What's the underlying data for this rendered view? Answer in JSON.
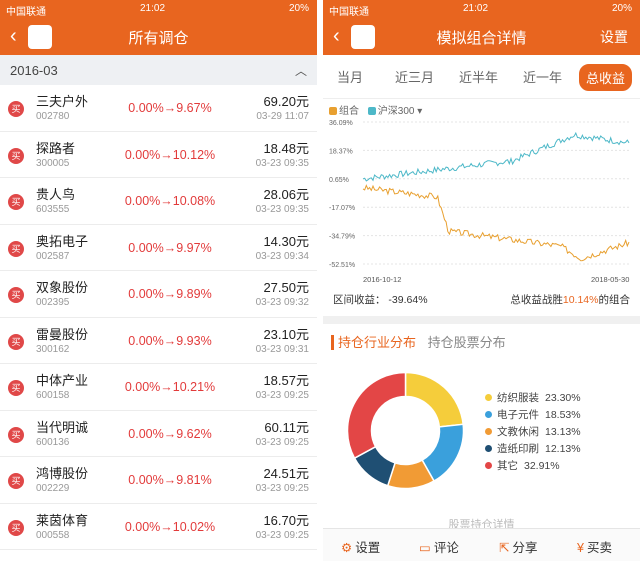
{
  "left": {
    "status": {
      "carrier": "中国联通",
      "time": "21:02",
      "battery": "20%"
    },
    "nav": {
      "title": "所有调仓"
    },
    "section": {
      "label": "2016-03"
    },
    "rows": [
      {
        "badge": "买",
        "name": "三夫户外",
        "code": "002780",
        "change": "0.00%→9.67%",
        "price": "69.20元",
        "time": "03-29 11:07"
      },
      {
        "badge": "买",
        "name": "探路者",
        "code": "300005",
        "change": "0.00%→10.12%",
        "price": "18.48元",
        "time": "03-23 09:35"
      },
      {
        "badge": "买",
        "name": "贵人鸟",
        "code": "603555",
        "change": "0.00%→10.08%",
        "price": "28.06元",
        "time": "03-23 09:35"
      },
      {
        "badge": "买",
        "name": "奥拓电子",
        "code": "002587",
        "change": "0.00%→9.97%",
        "price": "14.30元",
        "time": "03-23 09:34"
      },
      {
        "badge": "买",
        "name": "双象股份",
        "code": "002395",
        "change": "0.00%→9.89%",
        "price": "27.50元",
        "time": "03-23 09:32"
      },
      {
        "badge": "买",
        "name": "雷曼股份",
        "code": "300162",
        "change": "0.00%→9.93%",
        "price": "23.10元",
        "time": "03-23 09:31"
      },
      {
        "badge": "买",
        "name": "中体产业",
        "code": "600158",
        "change": "0.00%→10.21%",
        "price": "18.57元",
        "time": "03-23 09:25"
      },
      {
        "badge": "买",
        "name": "当代明诚",
        "code": "600136",
        "change": "0.00%→9.62%",
        "price": "60.11元",
        "time": "03-23 09:25"
      },
      {
        "badge": "买",
        "name": "鸿博股份",
        "code": "002229",
        "change": "0.00%→9.81%",
        "price": "24.51元",
        "time": "03-23 09:25"
      },
      {
        "badge": "买",
        "name": "莱茵体育",
        "code": "000558",
        "change": "0.00%→10.02%",
        "price": "16.70元",
        "time": "03-23 09:25"
      }
    ]
  },
  "right": {
    "status": {
      "carrier": "中国联通",
      "time": "21:02",
      "battery": "20%"
    },
    "nav": {
      "title": "模拟组合详情",
      "setting": "设置"
    },
    "tabs": [
      "当月",
      "近三月",
      "近半年",
      "近一年",
      "总收益"
    ],
    "legend": {
      "portfolio": "组合",
      "index": "沪深300 ▾"
    },
    "y_ticks": [
      "36.09%",
      "18.37%",
      "0.65%",
      "-17.07%",
      "-34.79%",
      "-52.51%"
    ],
    "x_ticks": [
      "2016-10-12",
      "2018-05-30"
    ],
    "stat_label": "区间收益：",
    "stat_value": "-39.64%",
    "beat_prefix": "总收益战胜",
    "beat_value": "10.14%",
    "beat_suffix": "的组合",
    "subtabs": [
      "持仓行业分布",
      "持仓股票分布"
    ],
    "pie": [
      {
        "label": "纺织服装",
        "value": "23.30%",
        "color": "#f5cd3b"
      },
      {
        "label": "电子元件",
        "value": "18.53%",
        "color": "#3aa0dc"
      },
      {
        "label": "文教休闲",
        "value": "13.13%",
        "color": "#f19b35"
      },
      {
        "label": "造纸印刷",
        "value": "12.13%",
        "color": "#1f4f73"
      },
      {
        "label": "其它",
        "value": "32.91%",
        "color": "#e34646"
      }
    ],
    "more": "股票持仓详情",
    "bottom": [
      {
        "icon": "⚙",
        "label": "设置"
      },
      {
        "icon": "▭",
        "label": "评论"
      },
      {
        "icon": "⇱",
        "label": "分享"
      },
      {
        "icon": "¥",
        "label": "买卖"
      }
    ]
  },
  "chart_data": {
    "type": "line",
    "x": [
      "2016-10-12",
      "2018-05-30"
    ],
    "series": [
      {
        "name": "组合",
        "color": "#e8a030",
        "start": 0.65,
        "end": -39.64
      },
      {
        "name": "沪深300",
        "color": "#4db8c8",
        "start": 0.65,
        "end": 25
      }
    ],
    "ylim": [
      -52.51,
      36.09
    ]
  }
}
